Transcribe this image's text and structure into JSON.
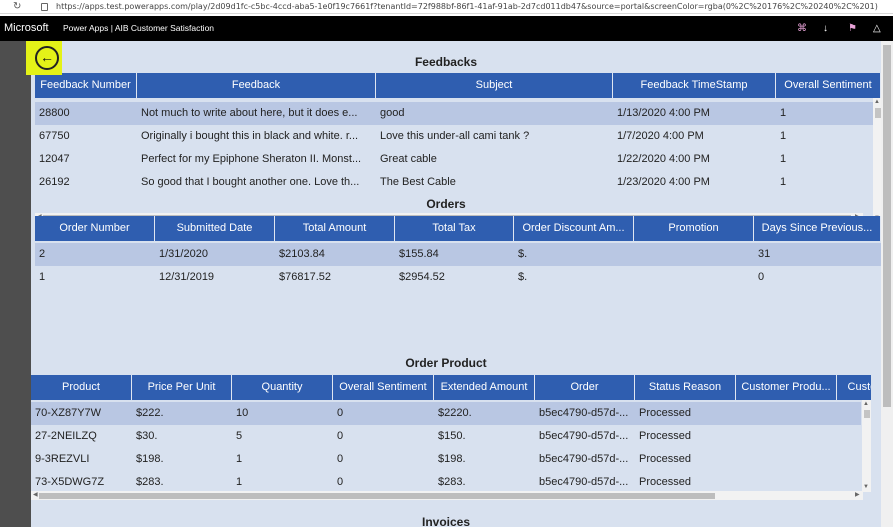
{
  "browser": {
    "url": "https://apps.test.powerapps.com/play/2d09d1fc-c5bc-4ccd-aba5-1e0f19c7661f?tenantId=72f988bf-86f1-41af-91ab-2d7cd011db47&source=portal&screenColor=rgba(0%2C%20176%2C%20240%2C%201)"
  },
  "header": {
    "brand": "Microsoft",
    "title": "Power Apps  |  AIB Customer Satisfaction",
    "icons": [
      "settings-icon",
      "download-icon",
      "flag-icon",
      "notification-icon"
    ]
  },
  "feedbacks": {
    "title": "Feedbacks",
    "columns": [
      "Feedback Number",
      "Feedback",
      "Subject",
      "Feedback TimeStamp",
      "Overall Sentiment"
    ],
    "rows": [
      [
        "28800",
        "Not much to write about here, but it does e...",
        "good",
        "1/13/2020 4:00 PM",
        "1"
      ],
      [
        "67750",
        "Originally i bought this in black and white. r...",
        "Love this under-all cami tank ?",
        "1/7/2020 4:00 PM",
        "1"
      ],
      [
        "12047",
        "Perfect for my Epiphone Sheraton II. Monst...",
        "Great cable",
        "1/22/2020 4:00 PM",
        "1"
      ],
      [
        "26192",
        "So good that I bought another one. Love th...",
        "The Best Cable",
        "1/23/2020 4:00 PM",
        "1"
      ]
    ]
  },
  "orders": {
    "title": "Orders",
    "columns": [
      "Order Number",
      "Submitted Date",
      "Total Amount",
      "Total Tax",
      "Order Discount Am...",
      "Promotion",
      "Days Since Previous..."
    ],
    "rows": [
      [
        "2",
        "1/31/2020",
        "$2103.84",
        "$155.84",
        "$.",
        "",
        "31"
      ],
      [
        "1",
        "12/31/2019",
        "$76817.52",
        "$2954.52",
        "$.",
        "",
        "0"
      ]
    ]
  },
  "order_product": {
    "title": "Order Product",
    "columns": [
      "Product",
      "Price Per Unit",
      "Quantity",
      "Overall Sentiment",
      "Extended Amount",
      "Order",
      "Status Reason",
      "Customer Produ...",
      "Custom"
    ],
    "rows": [
      [
        "70-XZ87Y7W",
        "$222.",
        "10",
        "0",
        "$2220.",
        "b5ec4790-d57d-...",
        "Processed",
        "",
        ""
      ],
      [
        "27-2NEILZQ",
        "$30.",
        "5",
        "0",
        "$150.",
        "b5ec4790-d57d-...",
        "Processed",
        "",
        ""
      ],
      [
        "9-3REZVLI",
        "$198.",
        "1",
        "0",
        "$198.",
        "b5ec4790-d57d-...",
        "Processed",
        "",
        ""
      ],
      [
        "73-X5DWG7Z",
        "$283.",
        "1",
        "0",
        "$283.",
        "b5ec4790-d57d-...",
        "Processed",
        "",
        ""
      ]
    ]
  },
  "invoices": {
    "title": "Invoices"
  },
  "colors": {
    "header_bg": "#2f5eb0",
    "canvas_bg": "#d8e1ef",
    "selected_row": "#b9c7e3",
    "back_highlight": "#e4f218"
  }
}
